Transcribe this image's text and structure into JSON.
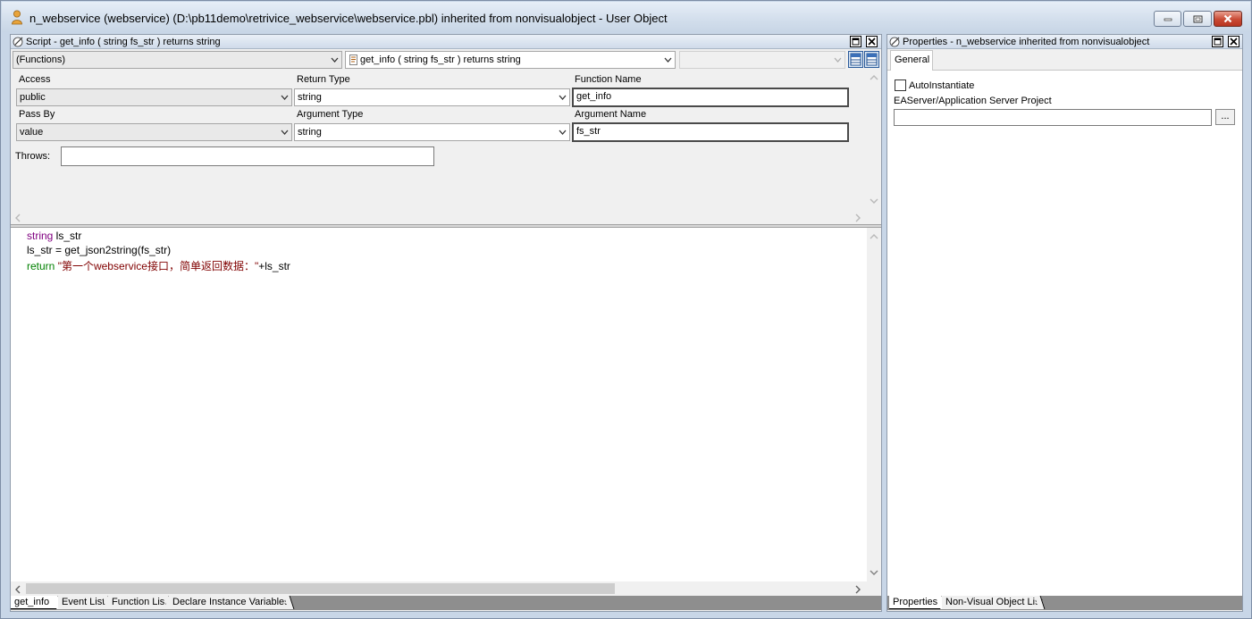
{
  "window": {
    "title": "n_webservice (webservice) (D:\\pb11demo\\retrivice_webservice\\webservice.pbl) inherited from nonvisualobject - User Object"
  },
  "script_pane": {
    "title": "Script - get_info ( string fs_str )  returns string",
    "object_dropdown": "(Functions)",
    "function_dropdown": "get_info ( string fs_str )  returns string",
    "third_dropdown": "",
    "labels": {
      "access": "Access",
      "return_type": "Return Type",
      "function_name": "Function Name",
      "pass_by": "Pass By",
      "argument_type": "Argument Type",
      "argument_name": "Argument Name",
      "throws": "Throws:"
    },
    "values": {
      "access": "public",
      "return_type": "string",
      "function_name": "get_info",
      "pass_by": "value",
      "argument_type": "string",
      "argument_name": "fs_str",
      "throws": ""
    },
    "code": {
      "line1_type": "string",
      "line1_rest": " ls_str",
      "line2": "ls_str = get_json2string(fs_str)",
      "line3_kw": "return",
      "line3_str": " \"第一个webservice接口，简单返回数据：\"",
      "line3_rest": "+ls_str"
    },
    "tabs": [
      "get_info",
      "Event List",
      "Function List",
      "Declare Instance Variables"
    ]
  },
  "properties_pane": {
    "title": "Properties - n_webservice  inherited  from  nonvisualobject",
    "tab_general": "General",
    "auto_instantiate": "AutoInstantiate",
    "easerver_label": "EAServer/Application Server Project",
    "easerver_value": "",
    "browse_button": "...",
    "tabs": [
      "Properties",
      "Non-Visual Object List"
    ]
  }
}
